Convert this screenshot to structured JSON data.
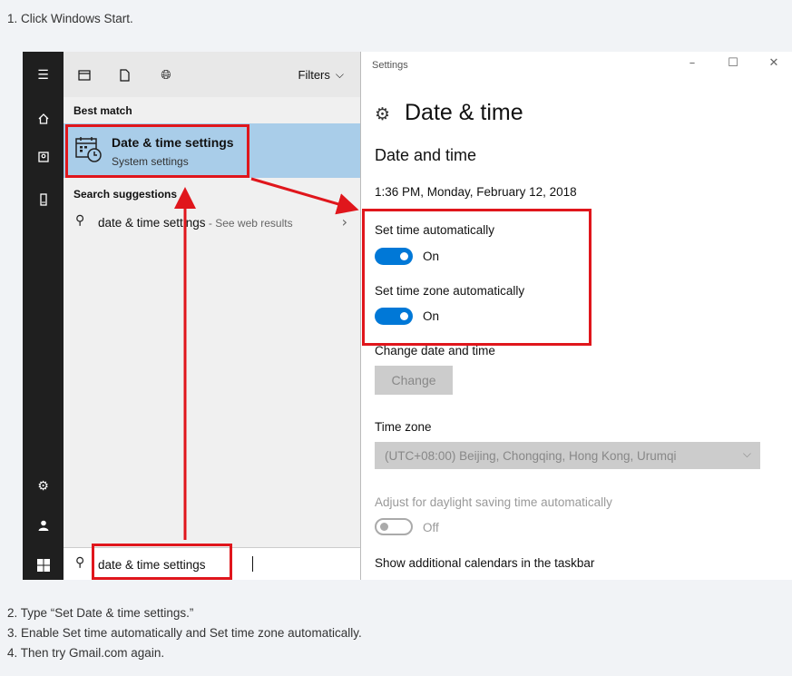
{
  "steps": {
    "step1": "1. Click Windows Start.",
    "step2": "2. Type “Set Date & time settings.”",
    "step3": "3. Enable Set time automatically and Set time zone automatically.",
    "step4": "4. Then try Gmail.com again."
  },
  "start_rail": {
    "icons": [
      "hamburger-icon",
      "home-icon",
      "camera-icon",
      "phone-icon",
      "gear-icon",
      "person-icon",
      "windows-logo-icon"
    ]
  },
  "search_panel": {
    "filters_label": "Filters",
    "best_match_label": "Best match",
    "best_match": {
      "title": "Date & time settings",
      "subtitle": "System settings"
    },
    "suggestions_label": "Search suggestions",
    "suggestion": {
      "text": "date & time settings",
      "hint": " - See web results"
    },
    "query": "date & time settings"
  },
  "settings": {
    "window_title": "Settings",
    "page_title": "Date & time",
    "section_title": "Date and time",
    "current_datetime": "1:36 PM, Monday, February 12, 2018",
    "set_time_auto_label": "Set time automatically",
    "set_time_auto_state": "On",
    "set_tz_auto_label": "Set time zone automatically",
    "set_tz_auto_state": "On",
    "change_label": "Change date and time",
    "change_button": "Change",
    "timezone_label": "Time zone",
    "timezone_value": "(UTC+08:00) Beijing, Chongqing, Hong Kong, Urumqi",
    "dst_label": "Adjust for daylight saving time automatically",
    "dst_state": "Off",
    "calendars_label": "Show additional calendars in the taskbar"
  },
  "colors": {
    "accent": "#0078d7",
    "highlight": "#e0161c",
    "selection": "#a9cde9"
  }
}
